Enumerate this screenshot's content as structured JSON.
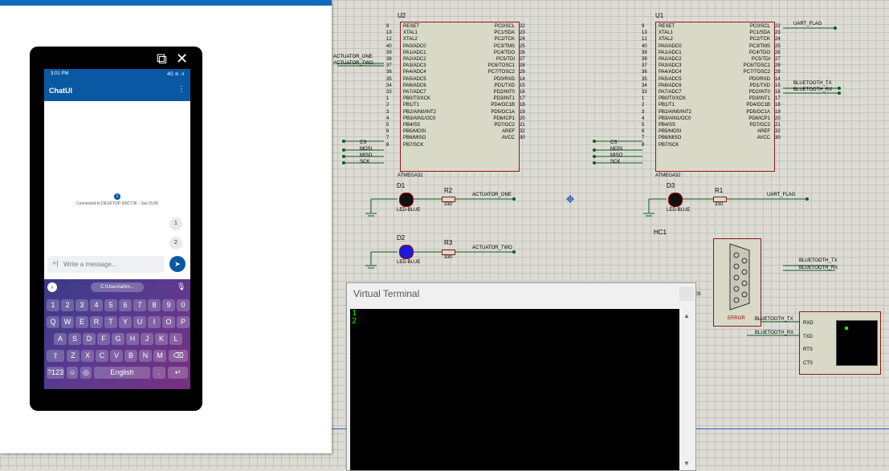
{
  "phone_panel": {
    "external_icon": "external-link-icon",
    "close_icon": "close-icon"
  },
  "phone": {
    "status_time": "3:01 PM",
    "status_signal": "4G ≋ .ıl",
    "app_title": "ChatUI",
    "menu_icon": "vertical-dots-icon",
    "connection_badge": "1",
    "connection_text": "Connected to DESKTOP-3I0CT3F · Sat 15:00",
    "messages": [
      "1",
      "2"
    ],
    "input_placeholder": "Write a message...",
    "send_icon": "send-icon",
    "clipboard_chip": "C:\\Users\\ahm...",
    "keyboard": {
      "row_numbers": [
        "1",
        "2",
        "3",
        "4",
        "5",
        "6",
        "7",
        "8",
        "9",
        "0"
      ],
      "row1": [
        "Q",
        "W",
        "E",
        "R",
        "T",
        "Y",
        "U",
        "I",
        "O",
        "P"
      ],
      "row2": [
        "A",
        "S",
        "D",
        "F",
        "G",
        "H",
        "J",
        "K",
        "L"
      ],
      "row3": [
        "Z",
        "X",
        "C",
        "V",
        "B",
        "N",
        "M"
      ],
      "sym_key": "?123",
      "space_label": "English",
      "period_key": "."
    }
  },
  "schematic": {
    "u2": {
      "ref": "U2",
      "part": "ATMEGA32",
      "left_pins": [
        "RESET",
        "XTAL1",
        "XTAL2",
        "PA0/ADC0",
        "PA1/ADC1",
        "PA2/ADC2",
        "PA3/ADC3",
        "PA4/ADC4",
        "PA5/ADC5",
        "PA6/ADC6",
        "PA7/ADC7",
        "PB0/T0/XCK",
        "PB1/T1",
        "PB2/AIN0/INT2",
        "PB3/AIN1/OC0",
        "PB4/SS",
        "PB5/MOSI",
        "PB6/MISO",
        "PB7/SCK"
      ],
      "left_nums": [
        "9",
        "13",
        "12",
        "40",
        "39",
        "38",
        "37",
        "36",
        "35",
        "34",
        "33",
        "1",
        "2",
        "3",
        "4",
        "5",
        "6",
        "7",
        "8"
      ],
      "right_pins": [
        "PC0/SCL",
        "PC1/SDA",
        "PC2/TCK",
        "PC3/TMS",
        "PC4/TDO",
        "PC5/TDI",
        "PC6/TOSC1",
        "PC7/TOSC2",
        "PD0/RXD",
        "PD1/TXD",
        "PD2/INT0",
        "PD3/INT1",
        "PD4/OC1B",
        "PD5/OC1A",
        "PD6/ICP1",
        "PD7/OC2",
        "AREF",
        "AVCC"
      ],
      "right_nums": [
        "22",
        "23",
        "24",
        "25",
        "26",
        "27",
        "28",
        "29",
        "14",
        "15",
        "16",
        "17",
        "18",
        "19",
        "20",
        "21",
        "32",
        "30"
      ],
      "net_labels": [
        "ACTUATOR_ONE",
        "ACTUATOR_TWO",
        "CS",
        "MOSI",
        "MISO",
        "SCK"
      ]
    },
    "u1": {
      "ref": "U1",
      "part": "ATMEGA32",
      "net_labels": [
        "UART_FLAG",
        "BLUETOOTH_TX",
        "BLUETOOTH_RX",
        "CS",
        "MOSI",
        "MISO",
        "SCK"
      ]
    },
    "d1": {
      "ref": "D1",
      "type": "LED-BLUE"
    },
    "d2": {
      "ref": "D2",
      "type": "LED-BLUE"
    },
    "d3": {
      "ref": "D3",
      "type": "LED-BLUE"
    },
    "r1": {
      "ref": "R1",
      "value": "330",
      "net": "UART_FLAG"
    },
    "r2": {
      "ref": "R2",
      "value": "330",
      "net": "ACTUATOR_ONE"
    },
    "r3": {
      "ref": "R3",
      "value": "330",
      "net": "ACTUATOR_TWO"
    },
    "hc1": {
      "ref": "HC1"
    },
    "connector": {
      "label": "ERROR",
      "nets": [
        "BLUETOOTH_TX",
        "BLUETOOTH_RX"
      ]
    },
    "uart": {
      "pins": [
        "RXD",
        "TXD",
        "RTS",
        "CTS"
      ],
      "nets": [
        "BLUETOOTH_TX",
        "BLUETOOTH_RX"
      ]
    },
    "stray": "05"
  },
  "virtual_terminal": {
    "title": "Virtual Terminal",
    "lines": [
      "1",
      "2"
    ]
  }
}
